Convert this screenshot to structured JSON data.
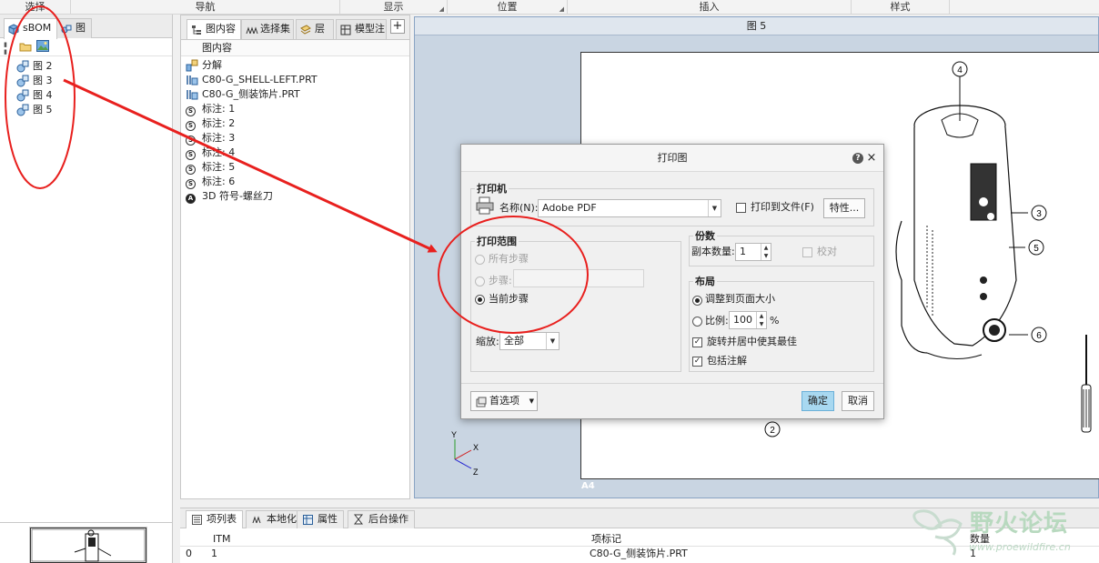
{
  "ribbon": {
    "groups": [
      {
        "label": "选择"
      },
      {
        "label": "导航"
      },
      {
        "label": "显示"
      },
      {
        "label": "位置"
      },
      {
        "label": "插入"
      },
      {
        "label": "样式"
      }
    ]
  },
  "left_panel": {
    "tabs": [
      {
        "label": "sBOM"
      },
      {
        "label": "图"
      }
    ],
    "tree": [
      {
        "label": "图 2"
      },
      {
        "label": "图 3"
      },
      {
        "label": "图 4"
      },
      {
        "label": "图 5"
      }
    ]
  },
  "middle_panel": {
    "tabs": [
      {
        "label": "图内容"
      },
      {
        "label": "选择集"
      },
      {
        "label": "层"
      },
      {
        "label": "模型注"
      }
    ],
    "add_tab": "+",
    "header": "图内容",
    "rows": [
      {
        "label": "分解",
        "icon": "explode-icon"
      },
      {
        "label": "C80-G_SHELL-LEFT.PRT",
        "icon": "part-icon"
      },
      {
        "label": "C80-G_侧装饰片.PRT",
        "icon": "part-icon"
      },
      {
        "label": "标注: 1",
        "icon": "annotation-s-icon",
        "glyph": "S"
      },
      {
        "label": "标注: 2",
        "icon": "annotation-s-icon",
        "glyph": "S"
      },
      {
        "label": "标注: 3",
        "icon": "annotation-s-icon",
        "glyph": "S"
      },
      {
        "label": "标注: 4",
        "icon": "annotation-s-icon",
        "glyph": "S"
      },
      {
        "label": "标注: 5",
        "icon": "annotation-s-icon",
        "glyph": "S"
      },
      {
        "label": "标注: 6",
        "icon": "annotation-s-icon",
        "glyph": "S"
      },
      {
        "label": "3D 符号-螺丝刀",
        "icon": "symbol-a-icon",
        "glyph": "A"
      }
    ]
  },
  "canvas": {
    "title": "图 5",
    "sheet_label": "A4",
    "balloons": [
      "4",
      "3",
      "5",
      "6",
      "2"
    ],
    "axes": {
      "x": "X",
      "y": "Y",
      "z": "Z"
    }
  },
  "dialog": {
    "title": "打印图",
    "help": "?",
    "close": "×",
    "printer": {
      "group": "打印机",
      "name_label": "名称(N):",
      "name_value": "Adobe PDF",
      "print_to_file": "打印到文件(F)",
      "print_to_file_checked": false,
      "properties": "特性..."
    },
    "range": {
      "group": "打印范围",
      "all_steps": "所有步骤",
      "step": "步骤:",
      "current_step": "当前步骤",
      "selected": "current_step"
    },
    "zoom": {
      "label": "缩放:",
      "value": "全部"
    },
    "copies": {
      "group": "份数",
      "count_label": "副本数量:",
      "count_value": "1",
      "collate": "校对"
    },
    "layout": {
      "group": "布局",
      "fit_page": "调整到页面大小",
      "scale": "比例:",
      "scale_value": "100",
      "scale_unit": "%",
      "rotate_center": "旋转并居中使其最佳",
      "rotate_center_checked": true,
      "include_annotations": "包括注解",
      "include_annotations_checked": true,
      "selected": "fit_page"
    },
    "preferences": "首选项",
    "ok": "确定",
    "cancel": "取消"
  },
  "bottom_panel": {
    "tabs": [
      {
        "label": "项列表"
      },
      {
        "label": "本地化"
      },
      {
        "label": "属性"
      },
      {
        "label": "后台操作"
      }
    ],
    "columns": [
      "ITM",
      "项标记",
      "数量"
    ],
    "rows": [
      {
        "index": "0",
        "itm": "1",
        "mark": "C80-G_侧装饰片.PRT",
        "qty": "1"
      }
    ]
  },
  "watermark": {
    "text": "野火论坛",
    "url": "www.proewildfire.cn"
  },
  "colors": {
    "annotation_red": "#e8201e",
    "ok_button": "#a8d8f0",
    "canvas_bg": "#c9d5e2"
  }
}
